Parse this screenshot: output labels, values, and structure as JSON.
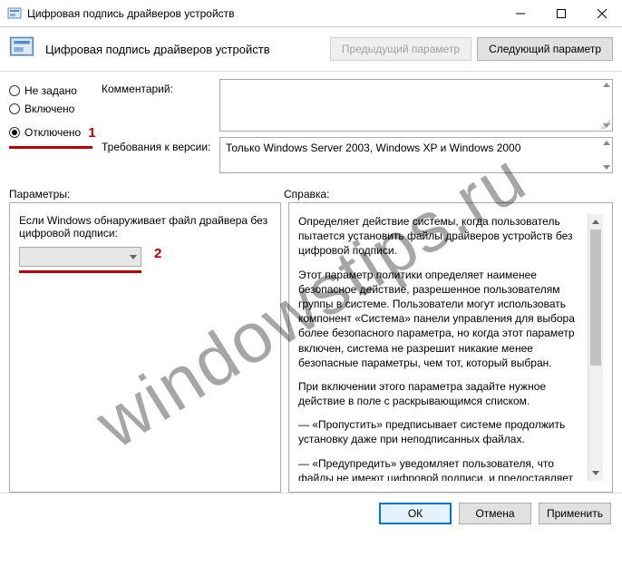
{
  "window": {
    "title": "Цифровая подпись драйверов устройств"
  },
  "header": {
    "title": "Цифровая подпись драйверов устройств",
    "prev_button": "Предыдущий параметр",
    "next_button": "Следующий параметр"
  },
  "radios": {
    "not_configured": "Не задано",
    "enabled": "Включено",
    "disabled": "Отключено"
  },
  "annotations": {
    "one": "1",
    "two": "2"
  },
  "fields": {
    "comment_label": "Комментарий:",
    "comment_value": "",
    "requirements_label": "Требования к версии:",
    "requirements_value": "Только Windows Server 2003, Windows XP и Windows 2000"
  },
  "section_labels": {
    "parameters": "Параметры:",
    "help": "Справка:"
  },
  "parameters_pane": {
    "prompt": "Если Windows обнаруживает файл драйвера без цифровой подписи:",
    "selected": ""
  },
  "help": {
    "p1": "Определяет действие системы, когда пользователь пытается установить файлы драйверов устройств без цифровой подписи.",
    "p2": "Этот параметр политики определяет наименее безопасное действие, разрешенное пользователям группы в системе. Пользователи могут использовать компонент «Система» панели управления для выбора более безопасного параметра, но когда этот параметр включен, система не разрешит никакие менее безопасные параметры, чем тот, который выбран.",
    "p3": "При включении этого параметра задайте нужное действие в поле с раскрывающимся списком.",
    "p4": "— «Пропустить» предписывает системе продолжить установку даже при неподписанных файлах.",
    "p5": "— «Предупредить» уведомляет пользователя, что файлы не имеют цифровой подписи, и предоставляет пользователю"
  },
  "buttons": {
    "ok": "ОК",
    "cancel": "Отмена",
    "apply": "Применить"
  },
  "watermark": "windowstips.ru"
}
